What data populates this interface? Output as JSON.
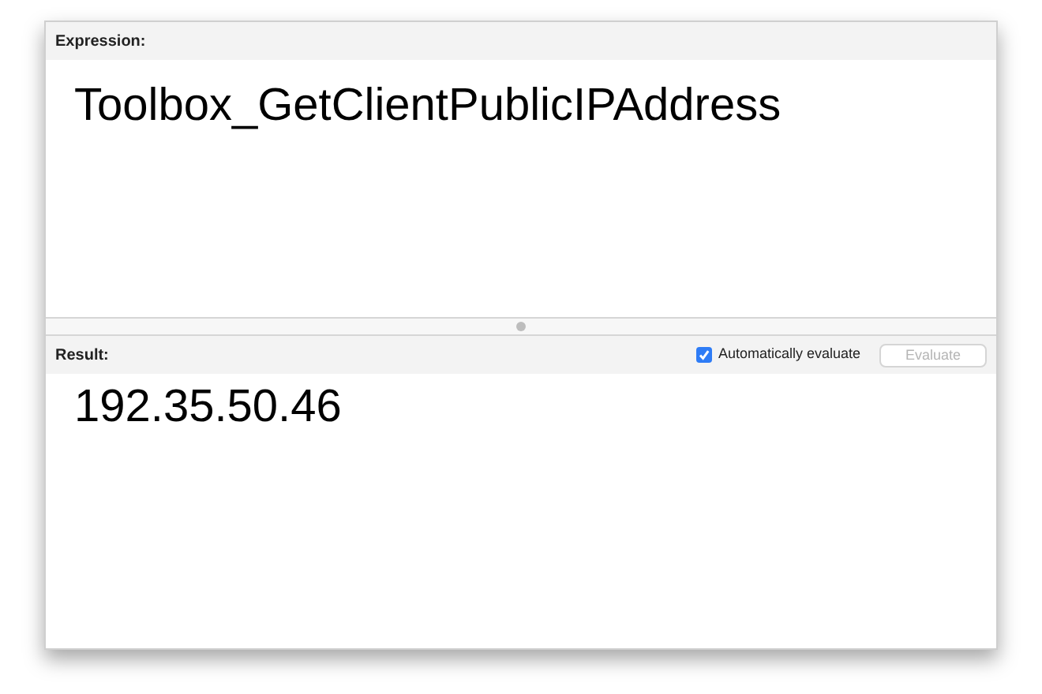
{
  "expression": {
    "label": "Expression:",
    "value": "Toolbox_GetClientPublicIPAddress"
  },
  "result": {
    "label": "Result:",
    "value": "192.35.50.46"
  },
  "auto_evaluate": {
    "label": "Automatically evaluate",
    "checked": true
  },
  "evaluate_button": {
    "label": "Evaluate",
    "disabled": true
  }
}
